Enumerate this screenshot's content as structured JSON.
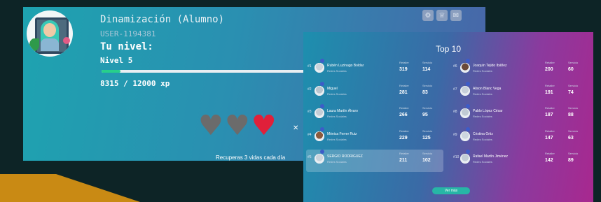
{
  "profile": {
    "title": "Dinamización (Alumno)",
    "user_id": "USER-1194381",
    "nivel_label": "Tu nivel:",
    "nivel": "Nivel 5",
    "xp_text": "8315 / 12000 xp",
    "xp_progress": 0.09,
    "lives_note": "Recuperas 3 vidas cada día",
    "lives": [
      {
        "state": "empty",
        "color": "#6b6b6b"
      },
      {
        "state": "empty",
        "color": "#6b6b6b"
      },
      {
        "state": "full",
        "color": "#e0203a"
      }
    ],
    "icons": [
      "settings-icon",
      "trophy-icon",
      "twitter-icon"
    ]
  },
  "leaderboard": {
    "title": "Top 10",
    "button_label": "Ver más",
    "left": [
      {
        "rank": "#1",
        "name": "Rubén Luzinago Boldar",
        "sub": "Redes Sociales",
        "col1": "Retailer",
        "col2": "Servicio",
        "v1": "319",
        "v2": "114",
        "highlight": false
      },
      {
        "rank": "#2",
        "name": "Miguel",
        "sub": "Redes Sociales",
        "col1": "Retailer",
        "col2": "Servicio",
        "v1": "281",
        "v2": "83",
        "highlight": false
      },
      {
        "rank": "#3",
        "name": "Laura Martín Álvaro",
        "sub": "Redes Sociales",
        "col1": "Retailer",
        "col2": "Servicio",
        "v1": "266",
        "v2": "95",
        "highlight": false
      },
      {
        "rank": "#4",
        "name": "Mónica Ferrer Ruiz",
        "sub": "Redes Sociales",
        "col1": "Retailer",
        "col2": "Servicio",
        "v1": "229",
        "v2": "125",
        "highlight": false
      },
      {
        "rank": "#5",
        "name": "SERGIO RODRIGUEZ",
        "sub": "Redes Sociales",
        "col1": "Retailer",
        "col2": "Servicio",
        "v1": "211",
        "v2": "102",
        "highlight": true
      }
    ],
    "right": [
      {
        "rank": "#6",
        "name": "Joaquín Tejido Ibáñez",
        "sub": "Redes Sociales",
        "col1": "Retailer",
        "col2": "Servicio",
        "v1": "200",
        "v2": "60"
      },
      {
        "rank": "#7",
        "name": "Alison Blanc Vega",
        "sub": "Redes Sociales",
        "col1": "Retailer",
        "col2": "Servicio",
        "v1": "191",
        "v2": "74"
      },
      {
        "rank": "#8",
        "name": "Pablo López César",
        "sub": "Redes Sociales",
        "col1": "Retailer",
        "col2": "Servicio",
        "v1": "187",
        "v2": "88"
      },
      {
        "rank": "#9",
        "name": "Cristina Ortiz",
        "sub": "Redes Sociales",
        "col1": "Retailer",
        "col2": "Servicio",
        "v1": "147",
        "v2": "63"
      },
      {
        "rank": "#10",
        "name": "Rafael Martín Jiménez",
        "sub": "Redes Sociales",
        "col1": "Retailer",
        "col2": "Servicio",
        "v1": "142",
        "v2": "89"
      }
    ]
  }
}
